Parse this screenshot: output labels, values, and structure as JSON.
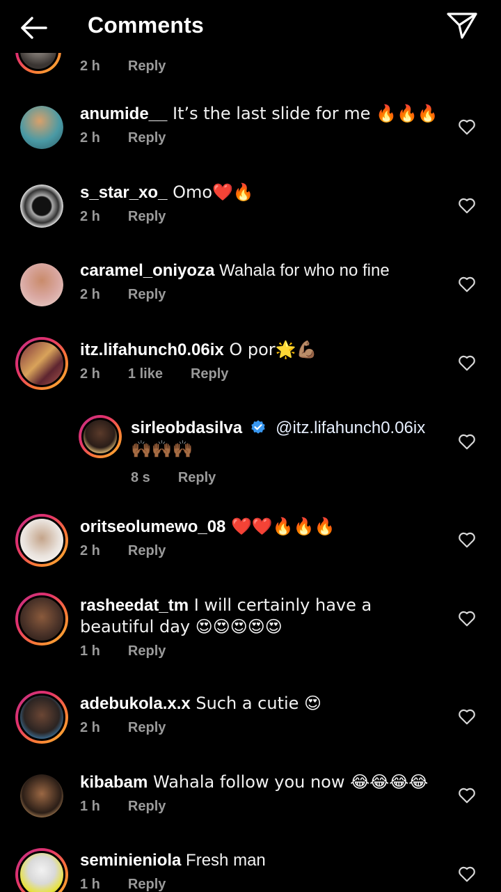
{
  "header": {
    "title": "Comments",
    "back_icon": "arrow-left-icon",
    "send_icon": "paper-plane-icon"
  },
  "top_partial": {
    "time": "2 h",
    "reply": "Reply"
  },
  "comments": [
    {
      "user": "anumide__",
      "text": " It’s the last slide for me 🔥🔥🔥",
      "time": "2 h",
      "likes": "",
      "reply": "Reply"
    },
    {
      "user": "s_star_xo_",
      "text": " Omo❤️🔥",
      "time": "2 h",
      "likes": "",
      "reply": "Reply"
    },
    {
      "user": "caramel_oniyoza",
      "text": " Wahala for who no fine",
      "time": "2 h",
      "likes": "",
      "reply": "Reply"
    },
    {
      "user": "itz.lifahunch0.06ix",
      "text": " O por🌟💪🏽",
      "time": "2 h",
      "likes": "1 like",
      "reply": "Reply"
    },
    {
      "user": "oritseolumewo_08",
      "text": " ❤️❤️🔥🔥🔥",
      "time": "2 h",
      "likes": "",
      "reply": "Reply"
    },
    {
      "user": "rasheedat_tm",
      "text": " I will certainly have a beautiful day 😍😍😍😍😍",
      "time": "1 h",
      "likes": "",
      "reply": "Reply"
    },
    {
      "user": "adebukola.x.x",
      "text": " Such a cutie 😍",
      "time": "2 h",
      "likes": "",
      "reply": "Reply"
    },
    {
      "user": "kibabam",
      "text": " Wahala follow you now 😂😂😂😂",
      "time": "1 h",
      "likes": "",
      "reply": "Reply"
    },
    {
      "user": "seminieniola",
      "text": " Fresh man",
      "time": "1 h",
      "likes": "",
      "reply": "Reply"
    }
  ],
  "reply_comment": {
    "user": "sirleobdasilva",
    "mention": "@itz.lifahunch0.06ix",
    "text": "🙌🏾🙌🏾🙌🏾",
    "time": "8 s",
    "reply": "Reply"
  },
  "colors": {
    "background": "#000000",
    "text": "#ffffff",
    "meta": "#9a9a9a",
    "verified": "#3897f0"
  }
}
